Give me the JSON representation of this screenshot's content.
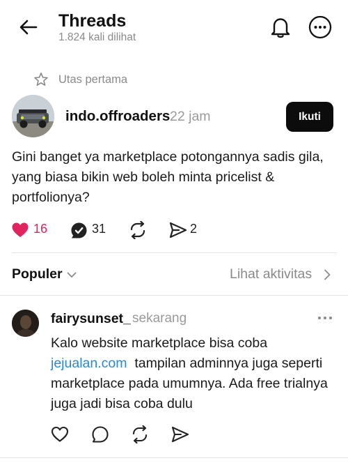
{
  "header": {
    "title": "Threads",
    "views": "1.824 kali dilihat",
    "icons": {
      "back": "back-arrow-icon",
      "notifications": "bell-icon",
      "more": "more-options-icon"
    }
  },
  "pinned": {
    "label": "Utas pertama",
    "icon": "star-icon"
  },
  "post": {
    "author": "indo.offroaders",
    "time": "22 jam",
    "follow_label": "Ikuti",
    "text": "Gini banget ya marketplace potongannya sadis gila, yang biasa bikin web boleh minta pricelist & portfolionya?",
    "likes": "16",
    "replies": "31",
    "shares": "2",
    "liked": true,
    "colors": {
      "like": "#e0245e",
      "follow_bg": "#0c0c0c"
    }
  },
  "sort": {
    "label": "Populer",
    "activity_label": "Lihat aktivitas"
  },
  "reply": {
    "author": "fairysunset_",
    "time": "sekarang",
    "text_before": "Kalo website marketplace bisa coba",
    "link": "jejualan.com",
    "text_after": "  tampilan adminnya juga seperti marketplace pada umumnya. Ada free trialnya juga jadi bisa coba dulu",
    "colors": {
      "link": "#2a88d6"
    }
  }
}
